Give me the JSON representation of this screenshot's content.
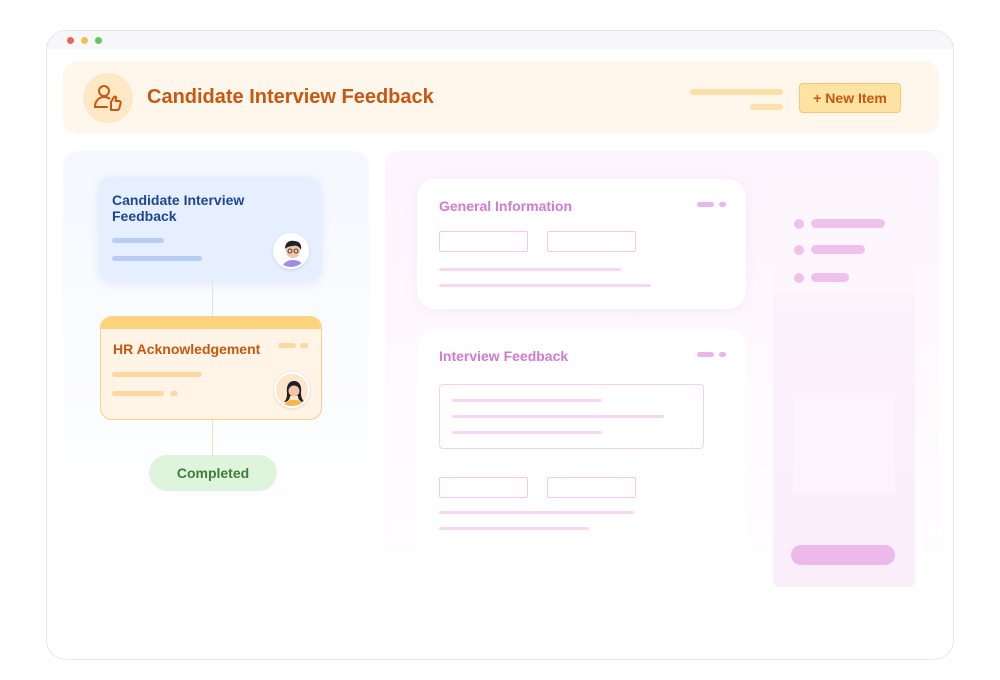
{
  "header": {
    "title": "Candidate Interview Feedback",
    "new_item_label": "+ New Item",
    "icon": "user-thumbs-up-icon"
  },
  "workflow": {
    "step1_title": "Candidate Interview Feedback",
    "step2_title": "HR Acknowledgement",
    "status_label": "Completed"
  },
  "form": {
    "section1_title": "General Information",
    "section2_title": "Interview Feedback"
  },
  "colors": {
    "accent_orange": "#c9570f",
    "blue_title": "#1d4695",
    "pink_title": "#d17ad2",
    "completed_green": "#3d7f37"
  }
}
